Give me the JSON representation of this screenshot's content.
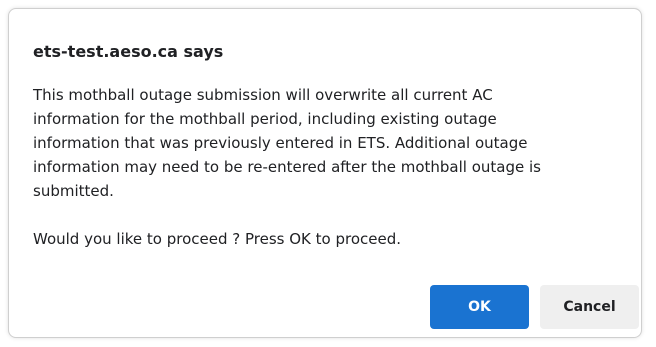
{
  "dialog": {
    "title": "ets-test.aeso.ca says",
    "message_lines": [
      "This mothball outage submission will overwrite all current AC",
      "information for the mothball period, including existing outage",
      "information that was previously entered in ETS.  Additional outage",
      "information may need to be re-entered after the mothball outage is",
      "submitted."
    ],
    "prompt": "Would you like to proceed ? Press OK to proceed.",
    "ok_label": "OK",
    "cancel_label": "Cancel"
  },
  "colors": {
    "ok_button": "#1a73d1",
    "cancel_button": "#efefef",
    "border": "#cfcfcf"
  }
}
